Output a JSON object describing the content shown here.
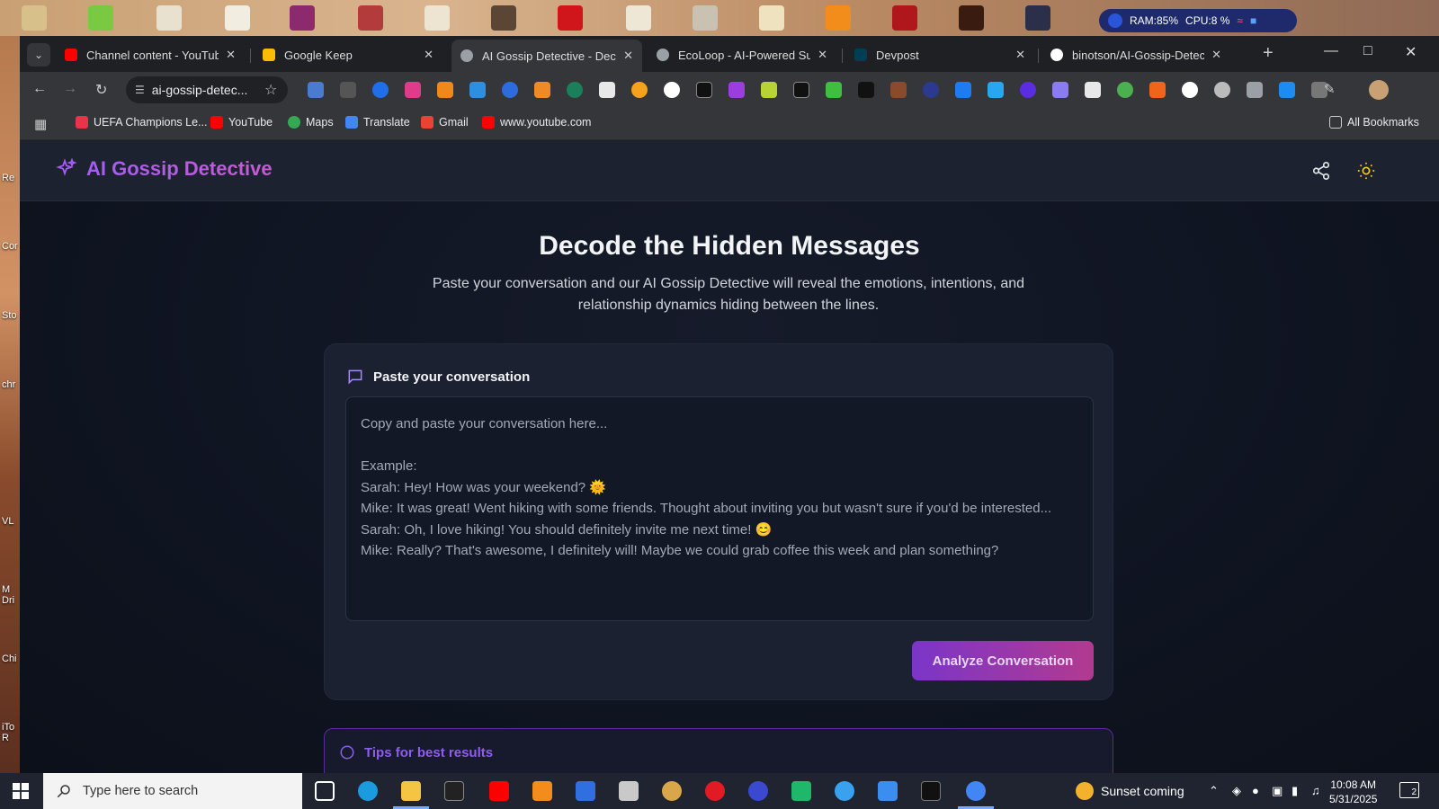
{
  "system": {
    "ram": "RAM:85%",
    "cpu": "CPU:8 %"
  },
  "desktop_labels": [
    "Re",
    "Cor",
    "Sto",
    "chr",
    "VL",
    "M\nDri",
    "Chi",
    "iTo\nR"
  ],
  "tabs": [
    {
      "title": "Channel content - YouTube S",
      "favicon": "youtube-icon",
      "color": "#ff0000"
    },
    {
      "title": "Google Keep",
      "favicon": "keep-icon",
      "color": "#fbbc04"
    },
    {
      "title": "AI Gossip Detective - Decode",
      "favicon": "globe-icon",
      "color": "#9aa0a6",
      "active": true
    },
    {
      "title": "EcoLoop - AI-Powered Susta",
      "favicon": "globe-icon",
      "color": "#9aa0a6"
    },
    {
      "title": "Devpost",
      "favicon": "devpost-icon",
      "color": "#003e54"
    },
    {
      "title": "binotson/AI-Gossip-Detectiv",
      "favicon": "github-icon",
      "color": "#ffffff"
    }
  ],
  "address_bar": {
    "url": "ai-gossip-detec..."
  },
  "bookmarks": [
    {
      "label": "UEFA Champions Le...",
      "icon": "uefa-icon",
      "color": "#e8334a"
    },
    {
      "label": "YouTube",
      "icon": "youtube-icon",
      "color": "#ff0000"
    },
    {
      "label": "Maps",
      "icon": "maps-icon",
      "color": "#34a853"
    },
    {
      "label": "Translate",
      "icon": "translate-icon",
      "color": "#4285f4"
    },
    {
      "label": "Gmail",
      "icon": "gmail-icon",
      "color": "#ea4335"
    },
    {
      "label": "www.youtube.com",
      "icon": "youtube-icon",
      "color": "#ff0000"
    }
  ],
  "all_bookmarks": "All Bookmarks",
  "app": {
    "brand": "AI Gossip Detective",
    "hero_title": "Decode the Hidden Messages",
    "hero_subtitle": "Paste your conversation and our AI Gossip Detective will reveal the emotions, intentions, and relationship dynamics hiding between the lines.",
    "card_title": "Paste your conversation",
    "placeholder": "Copy and paste your conversation here...\n\nExample:\nSarah: Hey! How was your weekend? 🌞\nMike: It was great! Went hiking with some friends. Thought about inviting you but wasn't sure if you'd be interested...\nSarah: Oh, I love hiking! You should definitely invite me next time! 😊\nMike: Really? That's awesome, I definitely will! Maybe we could grab coffee this week and plan something?",
    "analyze_label": "Analyze Conversation",
    "tips_title": "Tips for best results",
    "accent": "#a55cf5"
  },
  "taskbar": {
    "search_placeholder": "Type here to search",
    "weather": "Sunset coming",
    "time": "10:08 AM",
    "date": "5/31/2025",
    "notifications": "2"
  }
}
